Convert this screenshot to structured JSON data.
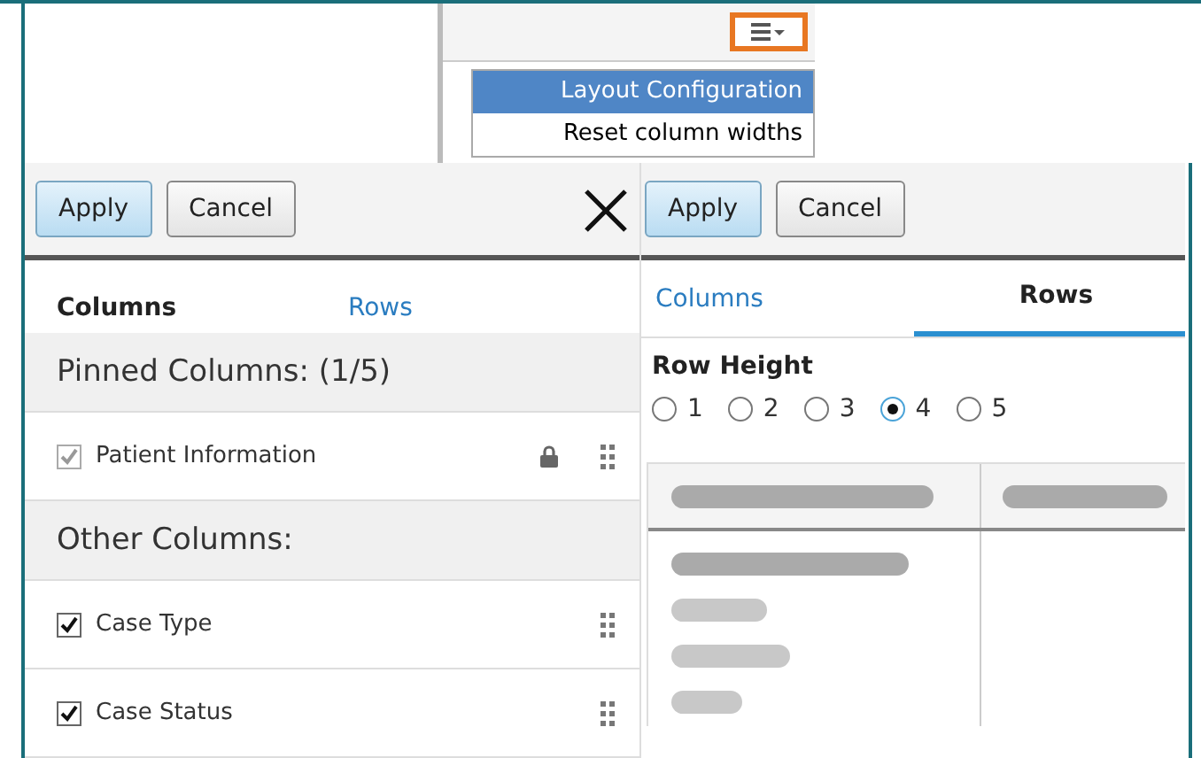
{
  "menu": {
    "items": [
      {
        "label": "Layout Configuration",
        "selected": true
      },
      {
        "label": "Reset column widths",
        "selected": false
      }
    ]
  },
  "left_panel": {
    "buttons": [
      "Apply",
      "Cancel"
    ],
    "tabs": [
      {
        "label": "Columns",
        "selected": true
      },
      {
        "label": "Rows",
        "selected": false
      }
    ],
    "sections": [
      {
        "title": "Pinned Columns: (1/5)",
        "items": [
          {
            "label": "Patient Information",
            "checked": true,
            "locked": true
          }
        ]
      },
      {
        "title": "Other Columns:",
        "items": [
          {
            "label": "Case Type",
            "checked": true,
            "locked": false
          },
          {
            "label": "Case Status",
            "checked": true,
            "locked": false
          }
        ]
      }
    ]
  },
  "right_panel": {
    "buttons": [
      "Apply",
      "Cancel"
    ],
    "tabs": [
      {
        "label": "Columns",
        "selected": false
      },
      {
        "label": "Rows",
        "selected": true
      }
    ],
    "row_height": {
      "label": "Row Height",
      "options": [
        {
          "label": "1",
          "selected": false
        },
        {
          "label": "2",
          "selected": false
        },
        {
          "label": "3",
          "selected": false
        },
        {
          "label": "4",
          "selected": true
        },
        {
          "label": "5",
          "selected": false
        }
      ]
    }
  }
}
